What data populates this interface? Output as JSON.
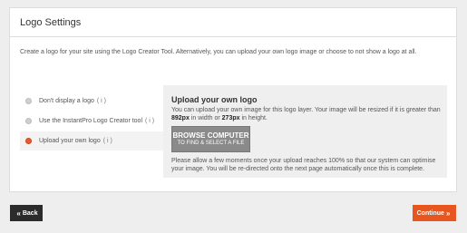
{
  "panel": {
    "title": "Logo Settings",
    "intro": "Create a logo for your site using the Logo Creator Tool. Alternatively, you can upload your own logo image or choose to not show a logo at all."
  },
  "options": [
    {
      "label": "Don't display a logo",
      "info": "( i )",
      "selected": false
    },
    {
      "label": "Use the InstantPro Logo Creator tool",
      "info": "( i )",
      "selected": false
    },
    {
      "label": "Upload your own logo",
      "info": "( i )",
      "selected": true
    }
  ],
  "upload": {
    "title": "Upload your own logo",
    "desc_part1": "You can upload your own image for this logo layer. Your image will be resized if it is greater than ",
    "width_value": "892px",
    "desc_part2": " in width or ",
    "height_value": "273px",
    "desc_part3": " in height.",
    "browse_line1": "BROWSE COMPUTER",
    "browse_line2": "TO FIND & SELECT A FILE",
    "note": "Please allow a few moments once your upload reaches 100% so that our system can optimise your image. You will be re-directed onto the next page automatically once this is complete."
  },
  "nav": {
    "back_arrow": "«",
    "back_label": "Back",
    "continue_label": "Continue",
    "continue_arrow": "»"
  },
  "colors": {
    "accent": "#e8561f",
    "dark_button": "#2b2b2b",
    "browse_button": "#8a8a8a"
  },
  "icons": {
    "back": "double-left-arrow-icon",
    "continue": "double-right-arrow-icon",
    "info": "info-icon",
    "radio": "radio-icon"
  }
}
